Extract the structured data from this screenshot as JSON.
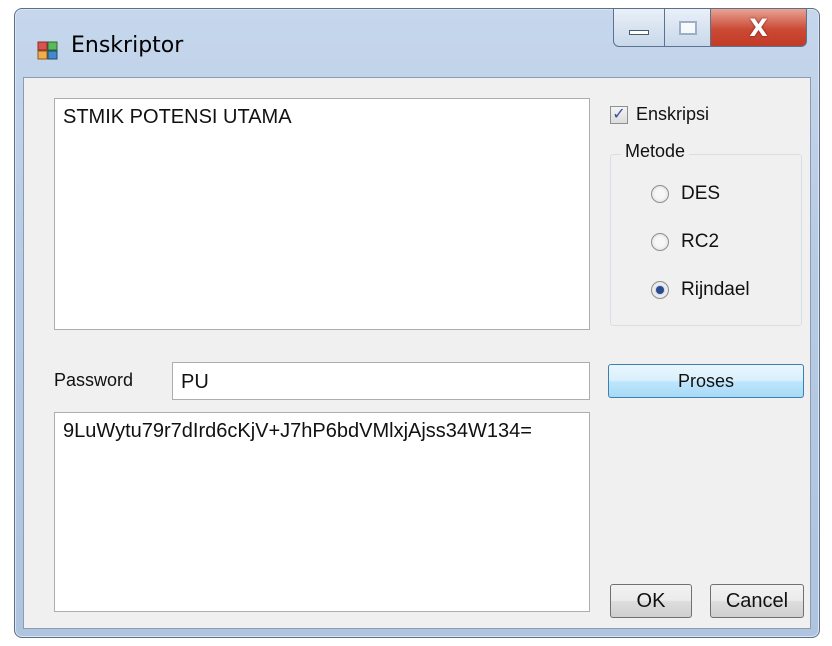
{
  "window": {
    "title": "Enskriptor",
    "close_symbol": "X"
  },
  "input": {
    "value": "STMIK POTENSI UTAMA"
  },
  "encrypt_option": {
    "label": "Enskripsi",
    "checked": true
  },
  "method": {
    "legend": "Metode",
    "options": [
      {
        "label": "DES",
        "selected": false
      },
      {
        "label": "RC2",
        "selected": false
      },
      {
        "label": "Rijndael",
        "selected": true
      }
    ]
  },
  "password": {
    "label": "Password",
    "value": "PU"
  },
  "buttons": {
    "process": "Proses",
    "ok": "OK",
    "cancel": "Cancel"
  },
  "output": {
    "value": "9LuWytu79r7dIrd6cKjV+J7hP6bdVMlxjAjss34W134="
  },
  "icons": {
    "app": "app-window-icon",
    "minimize": "minimize-icon",
    "maximize": "maximize-icon",
    "close": "close-icon",
    "checkmark": "checkmark-icon"
  },
  "colors": {
    "title_bar": "#b7cbe4",
    "close_button": "#c94b36",
    "client_bg": "#f0f0f0",
    "proses_button": "#bee6fd"
  }
}
